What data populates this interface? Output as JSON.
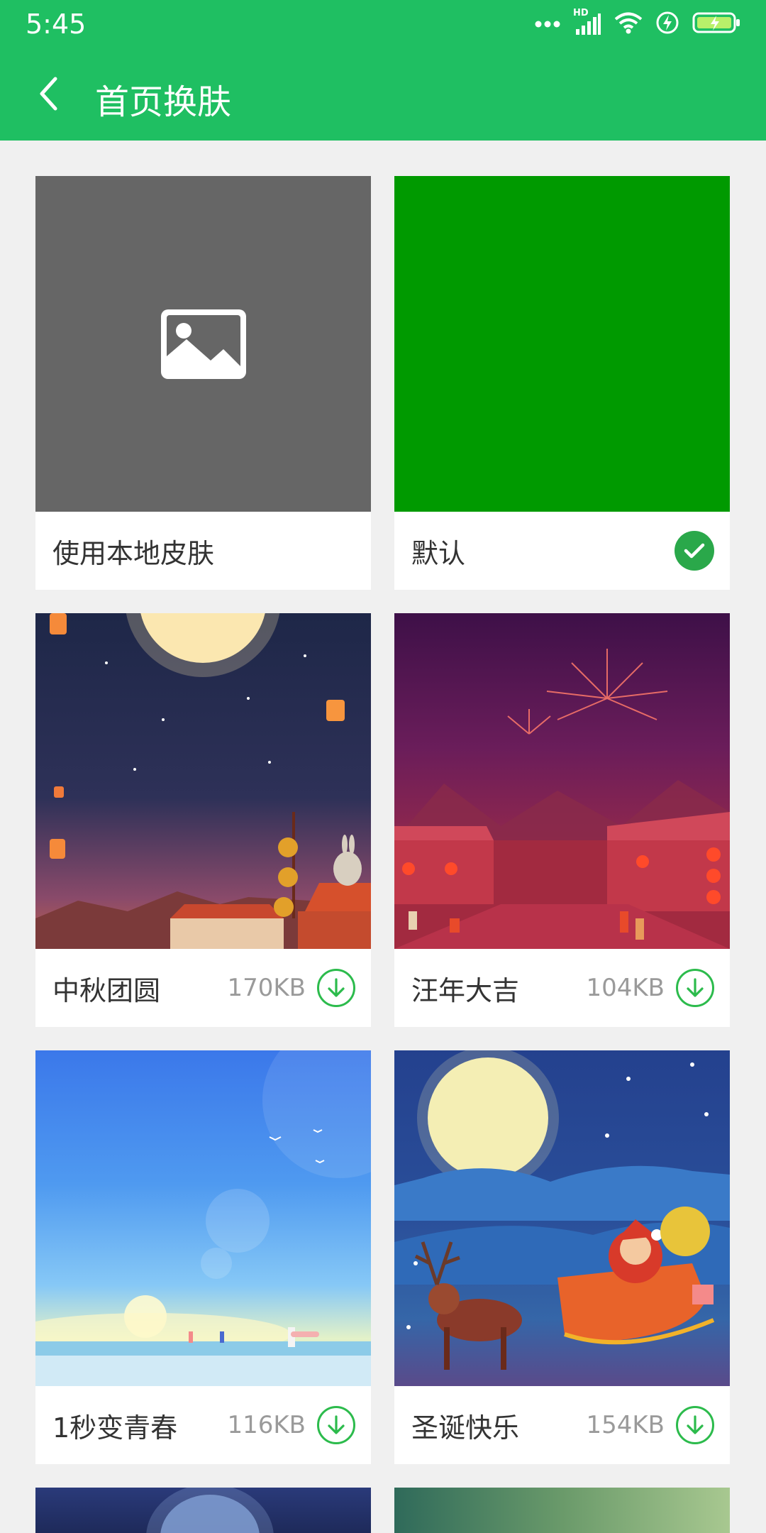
{
  "status_bar": {
    "time": "5:45",
    "network": "HD"
  },
  "header": {
    "title": "首页换肤",
    "back_icon": "chevron-left-icon"
  },
  "colors": {
    "primary": "#1fbf62",
    "default_skin": "#009a00",
    "download": "#2cbb4c",
    "selected": "#2aa84a"
  },
  "skins": [
    {
      "name": "使用本地皮肤",
      "size": "",
      "state": "local",
      "icon": "image-icon"
    },
    {
      "name": "默认",
      "size": "",
      "state": "selected",
      "icon": "check-icon"
    },
    {
      "name": "中秋团圆",
      "size": "170KB",
      "state": "download",
      "icon": "download-icon"
    },
    {
      "name": "汪年大吉",
      "size": "104KB",
      "state": "download",
      "icon": "download-icon"
    },
    {
      "name": "1秒变青春",
      "size": "116KB",
      "state": "download",
      "icon": "download-icon"
    },
    {
      "name": "圣诞快乐",
      "size": "154KB",
      "state": "download",
      "icon": "download-icon"
    }
  ]
}
